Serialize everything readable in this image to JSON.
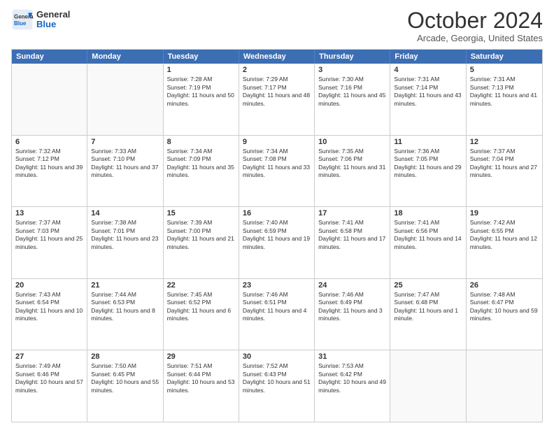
{
  "logo": {
    "line1": "General",
    "line2": "Blue"
  },
  "title": "October 2024",
  "location": "Arcade, Georgia, United States",
  "days": [
    "Sunday",
    "Monday",
    "Tuesday",
    "Wednesday",
    "Thursday",
    "Friday",
    "Saturday"
  ],
  "rows": [
    [
      {
        "day": "",
        "info": ""
      },
      {
        "day": "",
        "info": ""
      },
      {
        "day": "1",
        "info": "Sunrise: 7:28 AM\nSunset: 7:19 PM\nDaylight: 11 hours and 50 minutes."
      },
      {
        "day": "2",
        "info": "Sunrise: 7:29 AM\nSunset: 7:17 PM\nDaylight: 11 hours and 48 minutes."
      },
      {
        "day": "3",
        "info": "Sunrise: 7:30 AM\nSunset: 7:16 PM\nDaylight: 11 hours and 45 minutes."
      },
      {
        "day": "4",
        "info": "Sunrise: 7:31 AM\nSunset: 7:14 PM\nDaylight: 11 hours and 43 minutes."
      },
      {
        "day": "5",
        "info": "Sunrise: 7:31 AM\nSunset: 7:13 PM\nDaylight: 11 hours and 41 minutes."
      }
    ],
    [
      {
        "day": "6",
        "info": "Sunrise: 7:32 AM\nSunset: 7:12 PM\nDaylight: 11 hours and 39 minutes."
      },
      {
        "day": "7",
        "info": "Sunrise: 7:33 AM\nSunset: 7:10 PM\nDaylight: 11 hours and 37 minutes."
      },
      {
        "day": "8",
        "info": "Sunrise: 7:34 AM\nSunset: 7:09 PM\nDaylight: 11 hours and 35 minutes."
      },
      {
        "day": "9",
        "info": "Sunrise: 7:34 AM\nSunset: 7:08 PM\nDaylight: 11 hours and 33 minutes."
      },
      {
        "day": "10",
        "info": "Sunrise: 7:35 AM\nSunset: 7:06 PM\nDaylight: 11 hours and 31 minutes."
      },
      {
        "day": "11",
        "info": "Sunrise: 7:36 AM\nSunset: 7:05 PM\nDaylight: 11 hours and 29 minutes."
      },
      {
        "day": "12",
        "info": "Sunrise: 7:37 AM\nSunset: 7:04 PM\nDaylight: 11 hours and 27 minutes."
      }
    ],
    [
      {
        "day": "13",
        "info": "Sunrise: 7:37 AM\nSunset: 7:03 PM\nDaylight: 11 hours and 25 minutes."
      },
      {
        "day": "14",
        "info": "Sunrise: 7:38 AM\nSunset: 7:01 PM\nDaylight: 11 hours and 23 minutes."
      },
      {
        "day": "15",
        "info": "Sunrise: 7:39 AM\nSunset: 7:00 PM\nDaylight: 11 hours and 21 minutes."
      },
      {
        "day": "16",
        "info": "Sunrise: 7:40 AM\nSunset: 6:59 PM\nDaylight: 11 hours and 19 minutes."
      },
      {
        "day": "17",
        "info": "Sunrise: 7:41 AM\nSunset: 6:58 PM\nDaylight: 11 hours and 17 minutes."
      },
      {
        "day": "18",
        "info": "Sunrise: 7:41 AM\nSunset: 6:56 PM\nDaylight: 11 hours and 14 minutes."
      },
      {
        "day": "19",
        "info": "Sunrise: 7:42 AM\nSunset: 6:55 PM\nDaylight: 11 hours and 12 minutes."
      }
    ],
    [
      {
        "day": "20",
        "info": "Sunrise: 7:43 AM\nSunset: 6:54 PM\nDaylight: 11 hours and 10 minutes."
      },
      {
        "day": "21",
        "info": "Sunrise: 7:44 AM\nSunset: 6:53 PM\nDaylight: 11 hours and 8 minutes."
      },
      {
        "day": "22",
        "info": "Sunrise: 7:45 AM\nSunset: 6:52 PM\nDaylight: 11 hours and 6 minutes."
      },
      {
        "day": "23",
        "info": "Sunrise: 7:46 AM\nSunset: 6:51 PM\nDaylight: 11 hours and 4 minutes."
      },
      {
        "day": "24",
        "info": "Sunrise: 7:46 AM\nSunset: 6:49 PM\nDaylight: 11 hours and 3 minutes."
      },
      {
        "day": "25",
        "info": "Sunrise: 7:47 AM\nSunset: 6:48 PM\nDaylight: 11 hours and 1 minute."
      },
      {
        "day": "26",
        "info": "Sunrise: 7:48 AM\nSunset: 6:47 PM\nDaylight: 10 hours and 59 minutes."
      }
    ],
    [
      {
        "day": "27",
        "info": "Sunrise: 7:49 AM\nSunset: 6:46 PM\nDaylight: 10 hours and 57 minutes."
      },
      {
        "day": "28",
        "info": "Sunrise: 7:50 AM\nSunset: 6:45 PM\nDaylight: 10 hours and 55 minutes."
      },
      {
        "day": "29",
        "info": "Sunrise: 7:51 AM\nSunset: 6:44 PM\nDaylight: 10 hours and 53 minutes."
      },
      {
        "day": "30",
        "info": "Sunrise: 7:52 AM\nSunset: 6:43 PM\nDaylight: 10 hours and 51 minutes."
      },
      {
        "day": "31",
        "info": "Sunrise: 7:53 AM\nSunset: 6:42 PM\nDaylight: 10 hours and 49 minutes."
      },
      {
        "day": "",
        "info": ""
      },
      {
        "day": "",
        "info": ""
      }
    ]
  ]
}
